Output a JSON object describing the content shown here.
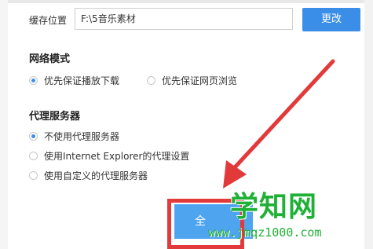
{
  "cache": {
    "label": "缓存位置",
    "path": "F:\\5音乐素材",
    "change_button": "更改"
  },
  "network": {
    "title": "网络模式",
    "options": [
      {
        "label": "优先保证播放下载",
        "selected": true
      },
      {
        "label": "优先保证网页浏览",
        "selected": false
      }
    ]
  },
  "proxy": {
    "title": "代理服务器",
    "options": [
      {
        "label": "不使用代理服务器",
        "selected": true
      },
      {
        "label": "使用Internet Explorer的代理设置",
        "selected": false
      },
      {
        "label": "使用自定义的代理服务器",
        "selected": false
      }
    ]
  },
  "footer": {
    "confirm_label": "全"
  },
  "watermark": {
    "brand": "学知网",
    "url": "www.jmqz1000.com"
  },
  "colors": {
    "accent": "#3b8ee8",
    "annotation_red": "#e23a3a",
    "watermark_green": "#1fb036"
  },
  "icons": {
    "annotation": "red-arrow-icon"
  }
}
